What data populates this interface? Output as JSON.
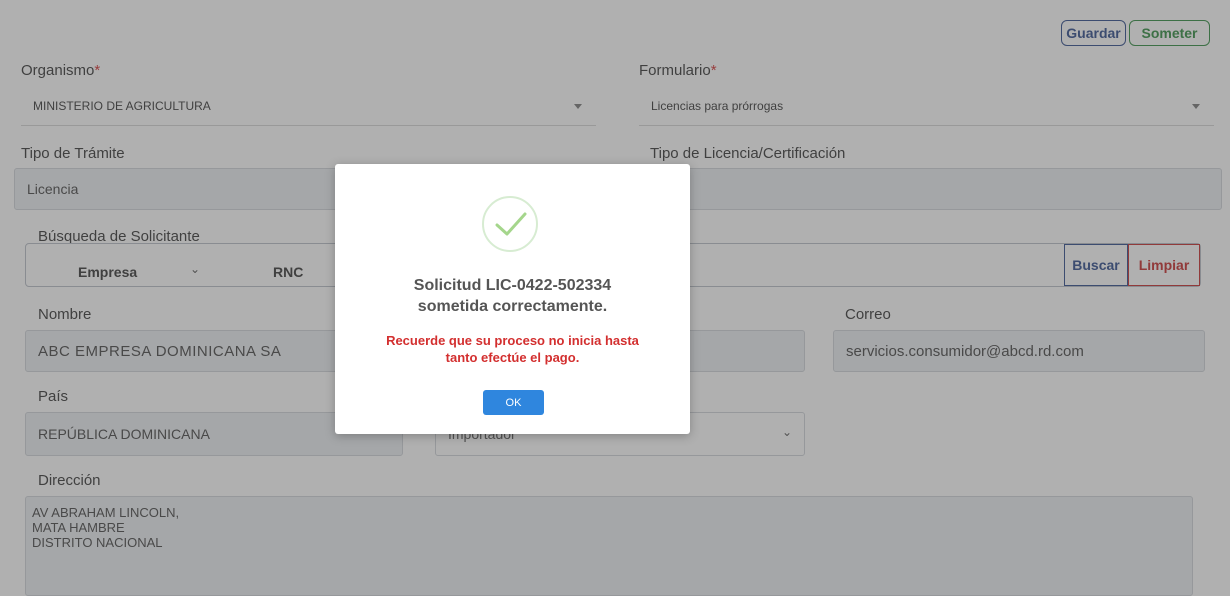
{
  "toolbar": {
    "save_label": "Guardar",
    "submit_label": "Someter"
  },
  "organismo": {
    "label": "Organismo",
    "required_mark": "*",
    "value": "MINISTERIO DE AGRICULTURA"
  },
  "formulario": {
    "label": "Formulario",
    "required_mark": "*",
    "value": "Licencias para prórrogas"
  },
  "tipo_tramite": {
    "label": "Tipo de Trámite",
    "value": "Licencia"
  },
  "tipo_licencia": {
    "label": "Tipo de Licencia/Certificación",
    "value": ""
  },
  "busqueda": {
    "label": "Búsqueda de Solicitante",
    "type_value": "Empresa",
    "id_type_label": "RNC",
    "search_label": "Buscar",
    "clear_label": "Limpiar"
  },
  "nombre": {
    "label": "Nombre",
    "value": "ABC EMPRESA DOMINICANA SA"
  },
  "correo": {
    "label": "Correo",
    "value": "servicios.consumidor@abcd.rd.com"
  },
  "pais": {
    "label": "País",
    "value": "REPÚBLICA DOMINICANA"
  },
  "tipo_solicitante": {
    "value": "Importador"
  },
  "direccion": {
    "label": "Dirección",
    "value": "AV ABRAHAM LINCOLN,\nMATA HAMBRE\nDISTRITO NACIONAL"
  },
  "modal": {
    "title": "Solicitud LIC-0422-502334 sometida correctamente.",
    "message": "Recuerde que su proceso no inicia hasta tanto efectúe el pago.",
    "ok_label": "OK",
    "icon": "check-icon"
  },
  "colors": {
    "primary": "#2d4a8a",
    "success": "#2e8b3e",
    "danger": "#c62828",
    "ok_button": "#2f86de"
  }
}
